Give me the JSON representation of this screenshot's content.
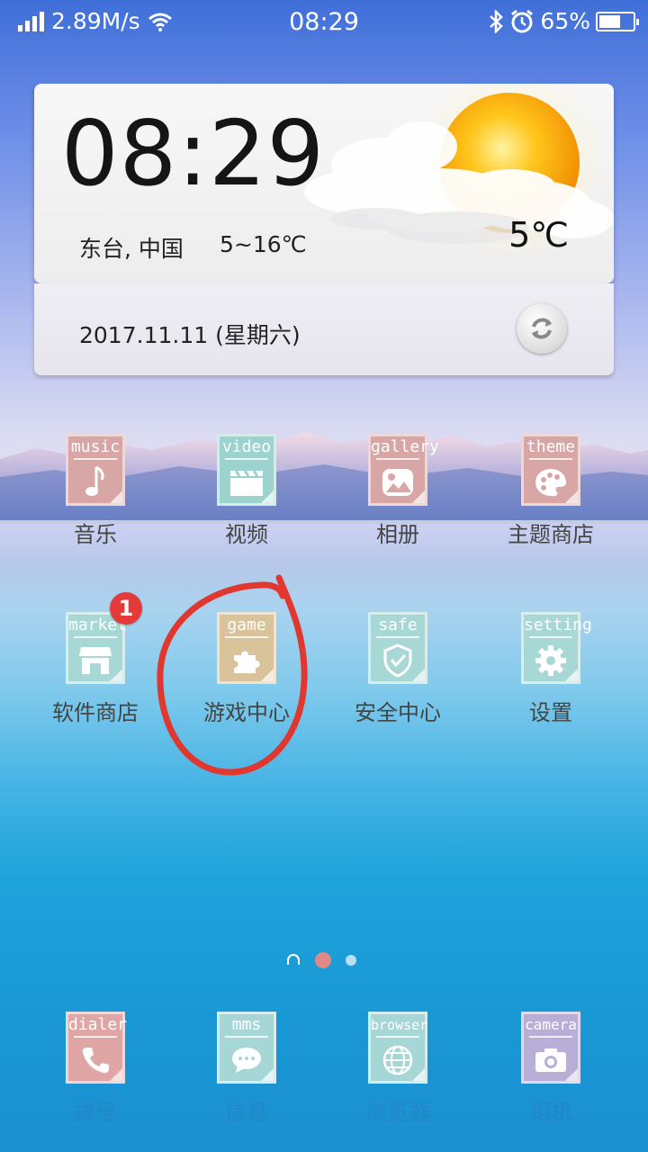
{
  "status_bar": {
    "network_speed": "2.89M/s",
    "time": "08:29",
    "battery_percent": "65%",
    "battery_level": 0.65,
    "icons": [
      "signal-icon",
      "wifi-icon",
      "bluetooth-icon",
      "alarm-icon",
      "battery-icon"
    ]
  },
  "widget": {
    "clock": "08:29",
    "location": "东台, 中国",
    "temp_range": "5~16℃",
    "current_temp": "5℃",
    "date": "2017.11.11 (星期六)",
    "weather_icon": "sunny-cloud-icon"
  },
  "apps_row1": [
    {
      "tag": "music",
      "label": "音乐",
      "color": "#d9a6a6"
    },
    {
      "tag": "video",
      "label": "视频",
      "color": "#9dd3cf"
    },
    {
      "tag": "gallery",
      "label": "相册",
      "color": "#d9a6a6"
    },
    {
      "tag": "theme",
      "label": "主题商店",
      "color": "#d9a6a6"
    }
  ],
  "apps_row2": [
    {
      "tag": "market",
      "label": "软件商店",
      "color": "#a8d8d6",
      "badge": "1"
    },
    {
      "tag": "game",
      "label": "游戏中心",
      "color": "#d9c39a"
    },
    {
      "tag": "safe",
      "label": "安全中心",
      "color": "#a8d8d6"
    },
    {
      "tag": "setting",
      "label": "设置",
      "color": "#a8d8d6"
    }
  ],
  "dock": [
    {
      "tag": "dialer",
      "label": "拨号",
      "color": "#e0a6a6"
    },
    {
      "tag": "mms",
      "label": "信息",
      "color": "#a6d6d6"
    },
    {
      "tag": "browser",
      "label": "浏览器",
      "color": "#a6d6d6"
    },
    {
      "tag": "camera",
      "label": "相机",
      "color": "#b8aed8"
    }
  ],
  "pager": {
    "pages": 2,
    "current": 1
  },
  "annotation": {
    "color": "#e0382e"
  }
}
